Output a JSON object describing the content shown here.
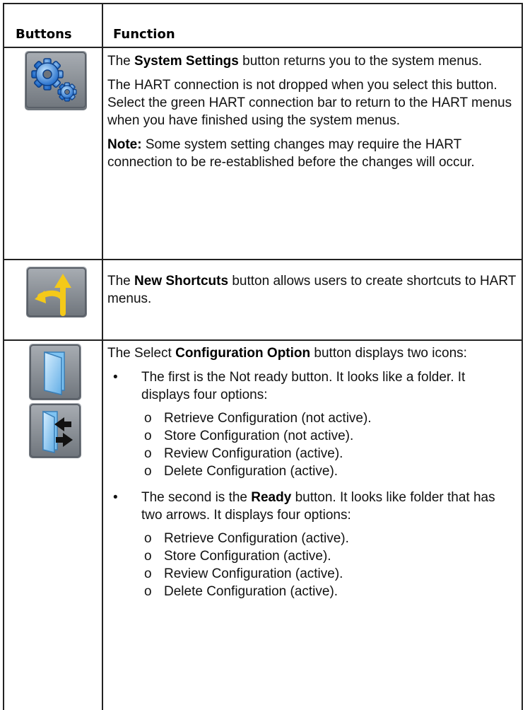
{
  "table": {
    "headers": {
      "buttons": "Buttons",
      "function": "Function"
    },
    "row1": {
      "icon": "gears-icon",
      "p1_pre": "The ",
      "p1_bold": "System Settings",
      "p1_post": " button returns you to the system menus.",
      "p2": "The HART connection is not dropped when you select this button.",
      "p3": "Select the green HART connection bar to return to the HART menus when you have finished using the system menus.",
      "note_label": "Note:",
      "note_text": " Some system setting changes may require the HART connection to be re-established before the changes will occur."
    },
    "row2": {
      "icon": "shortcut-arrows-icon",
      "pre": "The ",
      "bold": "New Shortcuts",
      "post": " button allows users to create shortcuts to HART menus."
    },
    "row3": {
      "icons": [
        "folder-icon",
        "folder-arrows-icon"
      ],
      "intro_pre": "The Select ",
      "intro_bold": "Configuration Option",
      "intro_post": " button displays two icons:",
      "bullet1": "The first is the Not ready button. It looks like a folder. It displays four options:",
      "bullet1_options": [
        "Retrieve Configuration (not active).",
        "Store Configuration (not active).",
        "Review Configuration (active).",
        "Delete Configuration (active)."
      ],
      "bullet2_pre": "The second is the ",
      "bullet2_bold": "Ready",
      "bullet2_post": " button. It looks like folder that has two arrows. It displays four options:",
      "bullet2_options": [
        "Retrieve Configuration (active).",
        "Store Configuration (active).",
        "Review Configuration (active).",
        "Delete Configuration (active)."
      ],
      "bullet_glyph": "•",
      "option_glyph": "o"
    }
  }
}
